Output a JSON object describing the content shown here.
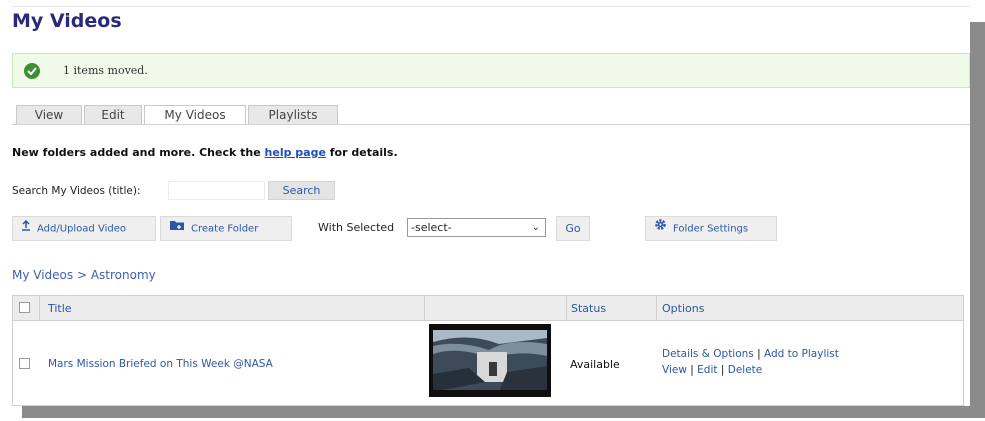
{
  "page": {
    "title": "My Videos"
  },
  "message": {
    "text": "1 items moved."
  },
  "tabs": [
    {
      "label": "View"
    },
    {
      "label": "Edit"
    },
    {
      "label": "My Videos"
    },
    {
      "label": "Playlists"
    }
  ],
  "notice": {
    "before": "New folders added and more. Check the ",
    "link": "help page",
    "after": " for details."
  },
  "search": {
    "label": "Search My Videos (title):",
    "value": "",
    "button": "Search"
  },
  "actions": {
    "add_upload": "Add/Upload Video",
    "create_folder": "Create Folder",
    "with_selected": "With Selected",
    "select_value": "-select-",
    "go": "Go",
    "folder_settings": "Folder Settings"
  },
  "breadcrumb": {
    "text": "My Videos > Astronomy"
  },
  "table": {
    "headers": {
      "title": "Title",
      "status": "Status",
      "options": "Options"
    },
    "rows": [
      {
        "title": "Mars Mission Briefed on This Week @NASA",
        "status": "Available",
        "options": {
          "details": "Details & Options",
          "add_playlist": "Add to Playlist",
          "view": "View",
          "edit": "Edit",
          "delete": "Delete"
        }
      }
    ]
  },
  "colors": {
    "title": "#2b2a7a",
    "link": "#2e56a8",
    "success": "#3e8e32"
  }
}
